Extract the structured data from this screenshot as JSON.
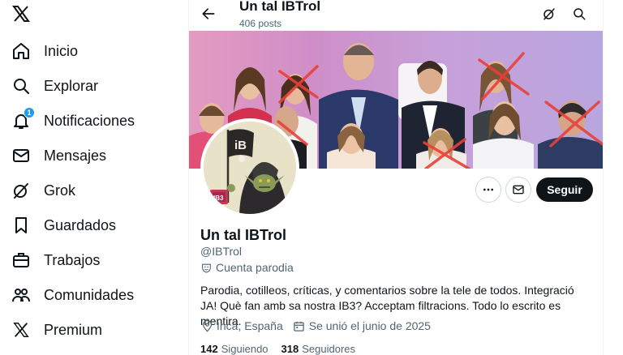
{
  "nav": {
    "items": [
      {
        "label": "Inicio",
        "icon": "home-icon"
      },
      {
        "label": "Explorar",
        "icon": "search-icon"
      },
      {
        "label": "Notificaciones",
        "icon": "bell-icon",
        "badge": "1"
      },
      {
        "label": "Mensajes",
        "icon": "mail-icon"
      },
      {
        "label": "Grok",
        "icon": "grok-icon"
      },
      {
        "label": "Guardados",
        "icon": "bookmark-icon"
      },
      {
        "label": "Trabajos",
        "icon": "briefcase-icon"
      },
      {
        "label": "Comunidades",
        "icon": "people-icon"
      },
      {
        "label": "Premium",
        "icon": "x-logo-icon"
      }
    ]
  },
  "header": {
    "title": "Un tal IBTrol",
    "posts": "406 posts"
  },
  "profile": {
    "name": "Un tal IBTrol",
    "handle": "@IBTrol",
    "parody_label": "Cuenta parodia",
    "bio": "Parodia, cotilleos, críticas, y comentarios sobre la tele de todos. Integració JA! Què fan amb sa nostra IB3? Acceptam filtracions. Todo lo escrito es mentira.",
    "location": "Inca, España",
    "joined": "Se unió el junio de 2025",
    "following_count": "142",
    "following_label": "Siguiendo",
    "followers_count": "318",
    "followers_label": "Seguidores"
  },
  "avatar": {
    "logo_text": "iB",
    "badge_text": "IB3"
  },
  "actions": {
    "follow_label": "Seguir"
  },
  "colors": {
    "accent": "#1d9bf0",
    "text": "#0f1419",
    "muted": "#536471",
    "cross": "#e8413a"
  }
}
